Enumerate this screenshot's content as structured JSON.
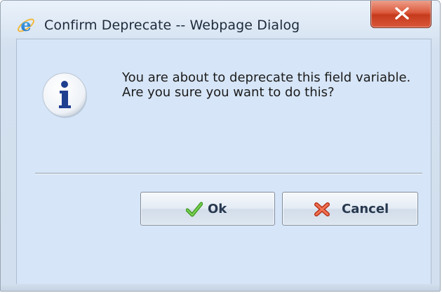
{
  "window": {
    "title": "Confirm Deprecate -- Webpage Dialog",
    "title_icon": "internet-explorer-icon",
    "close_icon": "close-icon"
  },
  "dialog": {
    "icon": "info-icon",
    "message": "You are about to deprecate this field variable. Are you sure you want to do this?"
  },
  "buttons": {
    "ok": {
      "label": "Ok",
      "icon": "checkmark-icon",
      "icon_color": "#4caf2a"
    },
    "cancel": {
      "label": "Cancel",
      "icon": "x-mark-icon",
      "icon_color": "#e2502a"
    }
  },
  "colors": {
    "content_bg": "#d6e5f7",
    "close_button": "#d9573a",
    "button_text": "#27384f"
  }
}
